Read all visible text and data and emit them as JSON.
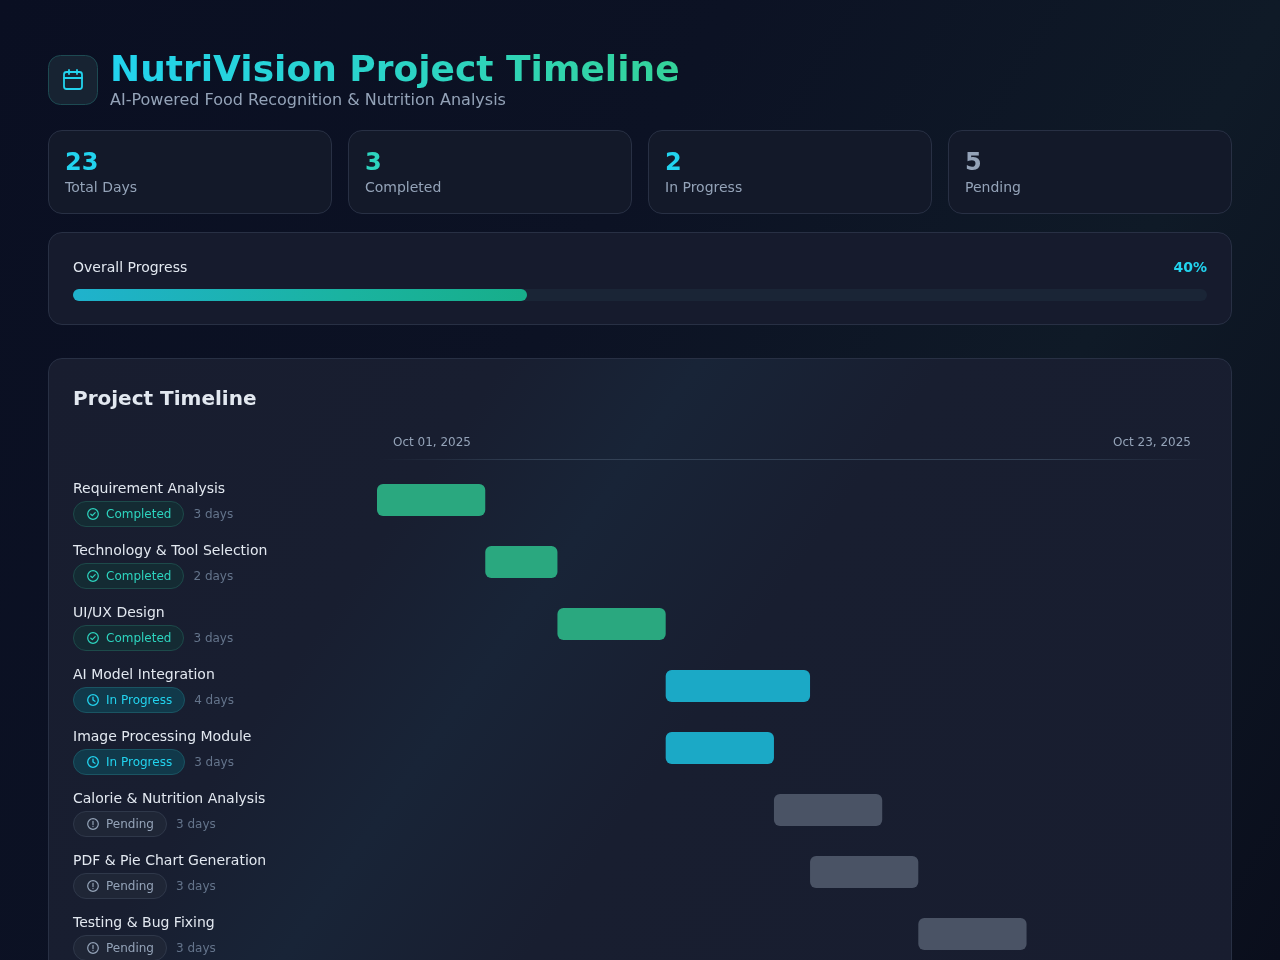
{
  "header": {
    "title": "NutriVision Project Timeline",
    "subtitle": "AI-Powered Food Recognition & Nutrition Analysis"
  },
  "stats": [
    {
      "value": "23",
      "label": "Total Days",
      "color": "#22d3ee"
    },
    {
      "value": "3",
      "label": "Completed",
      "color": "#2dd4bf"
    },
    {
      "value": "2",
      "label": "In Progress",
      "color": "#22d3ee"
    },
    {
      "value": "5",
      "label": "Pending",
      "color": "#94a3b8"
    }
  ],
  "progress": {
    "label": "Overall Progress",
    "percent": "40%",
    "level": 0.4
  },
  "timeline": {
    "title": "Project Timeline",
    "date_labels": [
      "Oct 01, 2025",
      "Oct 23, 2025"
    ],
    "tasks": [
      {
        "name": "Requirement Analysis",
        "kind": "completed",
        "status": "Completed",
        "duration": "3 days"
      },
      {
        "name": "Technology & Tool Selection",
        "kind": "completed",
        "status": "Completed",
        "duration": "2 days"
      },
      {
        "name": "UI/UX Design",
        "kind": "completed",
        "status": "Completed",
        "duration": "3 days"
      },
      {
        "name": "AI Model Integration",
        "kind": "in_progress",
        "status": "In Progress",
        "duration": "4 days"
      },
      {
        "name": "Image Processing Module",
        "kind": "in_progress",
        "status": "In Progress",
        "duration": "3 days"
      },
      {
        "name": "Calorie & Nutrition Analysis",
        "kind": "pending",
        "status": "Pending",
        "duration": "3 days"
      },
      {
        "name": "PDF & Pie Chart Generation",
        "kind": "pending",
        "status": "Pending",
        "duration": "3 days"
      },
      {
        "name": "Testing & Bug Fixing",
        "kind": "pending",
        "status": "Pending",
        "duration": "3 days"
      }
    ]
  }
}
